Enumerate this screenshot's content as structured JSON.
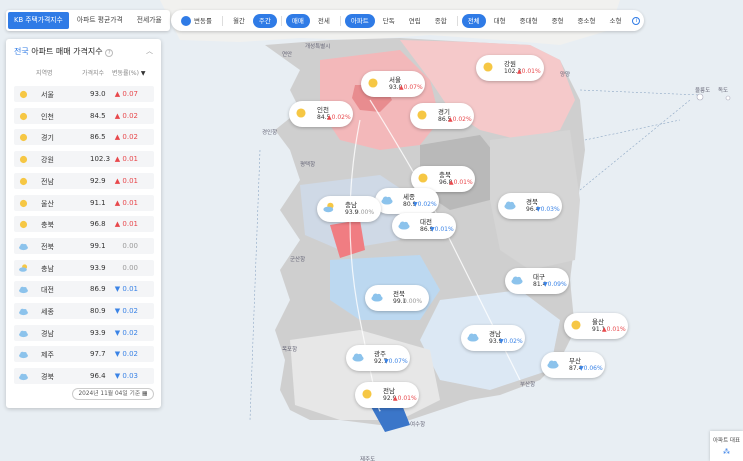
{
  "tabs": [
    {
      "label": "KB 주택가격지수",
      "active": true
    },
    {
      "label": "아파트 평균가격",
      "active": false
    },
    {
      "label": "전세가율",
      "active": false
    }
  ],
  "toggle_label": "변동률",
  "period": [
    {
      "label": "월간",
      "active": false
    },
    {
      "label": "주간",
      "active": true
    }
  ],
  "deal": [
    {
      "label": "매매",
      "active": true
    },
    {
      "label": "전세",
      "active": false
    }
  ],
  "house_type": [
    {
      "label": "아파트",
      "active": true
    },
    {
      "label": "단독",
      "active": false
    },
    {
      "label": "연립",
      "active": false
    },
    {
      "label": "종합",
      "active": false
    }
  ],
  "size": [
    {
      "label": "전체",
      "active": true
    },
    {
      "label": "대형",
      "active": false
    },
    {
      "label": "중대형",
      "active": false
    },
    {
      "label": "중형",
      "active": false
    },
    {
      "label": "중소형",
      "active": false
    },
    {
      "label": "소형",
      "active": false
    }
  ],
  "info_icon": "i",
  "panel": {
    "title_prefix": "전국",
    "title_rest": "아파트 매매 가격지수",
    "help": "?",
    "collapse": "︿",
    "columns": {
      "region": "지역명",
      "index": "가격지수",
      "change": "변동률(%)",
      "sort": "▼"
    },
    "date": "2024년 11월 04일 기준"
  },
  "colors": {
    "up": "#e8484c",
    "down": "#3a83e6",
    "flat": "#999999",
    "accent": "#2f7be6",
    "sun": "#f6c744",
    "cloud": "#8cc3ec"
  },
  "regions": [
    {
      "name": "서울",
      "index": "93.0",
      "dir": "up",
      "change": "0.07",
      "weather": "sun-icon"
    },
    {
      "name": "인천",
      "index": "84.5",
      "dir": "up",
      "change": "0.02",
      "weather": "sun-icon"
    },
    {
      "name": "경기",
      "index": "86.5",
      "dir": "up",
      "change": "0.02",
      "weather": "sun-icon"
    },
    {
      "name": "강원",
      "index": "102.3",
      "dir": "up",
      "change": "0.01",
      "weather": "sun-icon"
    },
    {
      "name": "전남",
      "index": "92.9",
      "dir": "up",
      "change": "0.01",
      "weather": "sun-icon"
    },
    {
      "name": "울산",
      "index": "91.1",
      "dir": "up",
      "change": "0.01",
      "weather": "sun-icon"
    },
    {
      "name": "충북",
      "index": "96.8",
      "dir": "up",
      "change": "0.01",
      "weather": "sun-icon"
    },
    {
      "name": "전북",
      "index": "99.1",
      "dir": "flat",
      "change": "0.00",
      "weather": "cloud-icon"
    },
    {
      "name": "충남",
      "index": "93.9",
      "dir": "flat",
      "change": "0.00",
      "weather": "partly-cloudy-icon"
    },
    {
      "name": "대전",
      "index": "86.9",
      "dir": "down",
      "change": "0.01",
      "weather": "cloud-icon"
    },
    {
      "name": "세종",
      "index": "80.9",
      "dir": "down",
      "change": "0.02",
      "weather": "cloud-icon"
    },
    {
      "name": "경남",
      "index": "93.9",
      "dir": "down",
      "change": "0.02",
      "weather": "cloud-icon"
    },
    {
      "name": "제주",
      "index": "97.7",
      "dir": "down",
      "change": "0.02",
      "weather": "cloud-icon"
    },
    {
      "name": "경북",
      "index": "96.4",
      "dir": "down",
      "change": "0.03",
      "weather": "cloud-icon"
    }
  ],
  "map_labels": [
    {
      "name": "강원",
      "index": "102.3",
      "dir": "up",
      "change": "0.01",
      "weather": "sun-icon"
    },
    {
      "name": "서울",
      "index": "93.0",
      "dir": "up",
      "change": "0.07",
      "weather": "sun-icon"
    },
    {
      "name": "인천",
      "index": "84.5",
      "dir": "up",
      "change": "0.02",
      "weather": "sun-icon"
    },
    {
      "name": "경기",
      "index": "86.5",
      "dir": "up",
      "change": "0.02",
      "weather": "sun-icon"
    },
    {
      "name": "충북",
      "index": "96.8",
      "dir": "up",
      "change": "0.01",
      "weather": "sun-icon"
    },
    {
      "name": "세종",
      "index": "80.9",
      "dir": "down",
      "change": "0.02",
      "weather": "cloud-icon"
    },
    {
      "name": "충남",
      "index": "93.9",
      "dir": "flat",
      "change": "0.00",
      "weather": "partly-cloudy-icon"
    },
    {
      "name": "경북",
      "index": "96.4",
      "dir": "down",
      "change": "0.03",
      "weather": "cloud-icon"
    },
    {
      "name": "대전",
      "index": "86.9",
      "dir": "down",
      "change": "0.01",
      "weather": "cloud-icon"
    },
    {
      "name": "대구",
      "index": "81.4",
      "dir": "down",
      "change": "0.09",
      "weather": "cloud-icon"
    },
    {
      "name": "전북",
      "index": "99.1",
      "dir": "flat",
      "change": "0.00",
      "weather": "cloud-icon"
    },
    {
      "name": "울산",
      "index": "91.1",
      "dir": "up",
      "change": "0.01",
      "weather": "sun-icon"
    },
    {
      "name": "경남",
      "index": "93.9",
      "dir": "down",
      "change": "0.02",
      "weather": "cloud-icon"
    },
    {
      "name": "광주",
      "index": "92.7",
      "dir": "down",
      "change": "0.07",
      "weather": "cloud-icon"
    },
    {
      "name": "부산",
      "index": "87.4",
      "dir": "down",
      "change": "0.06",
      "weather": "cloud-icon"
    },
    {
      "name": "전남",
      "index": "92.9",
      "dir": "up",
      "change": "0.01",
      "weather": "sun-icon"
    }
  ],
  "map_text": [
    "개성특별시",
    "연안",
    "양양",
    "울릉도",
    "독도",
    "경인항",
    "평택항",
    "군산항",
    "목포항",
    "여수항",
    "부산항",
    "제주도"
  ],
  "corner": {
    "label": "아파트 대표",
    "icon": "chart-icon"
  }
}
